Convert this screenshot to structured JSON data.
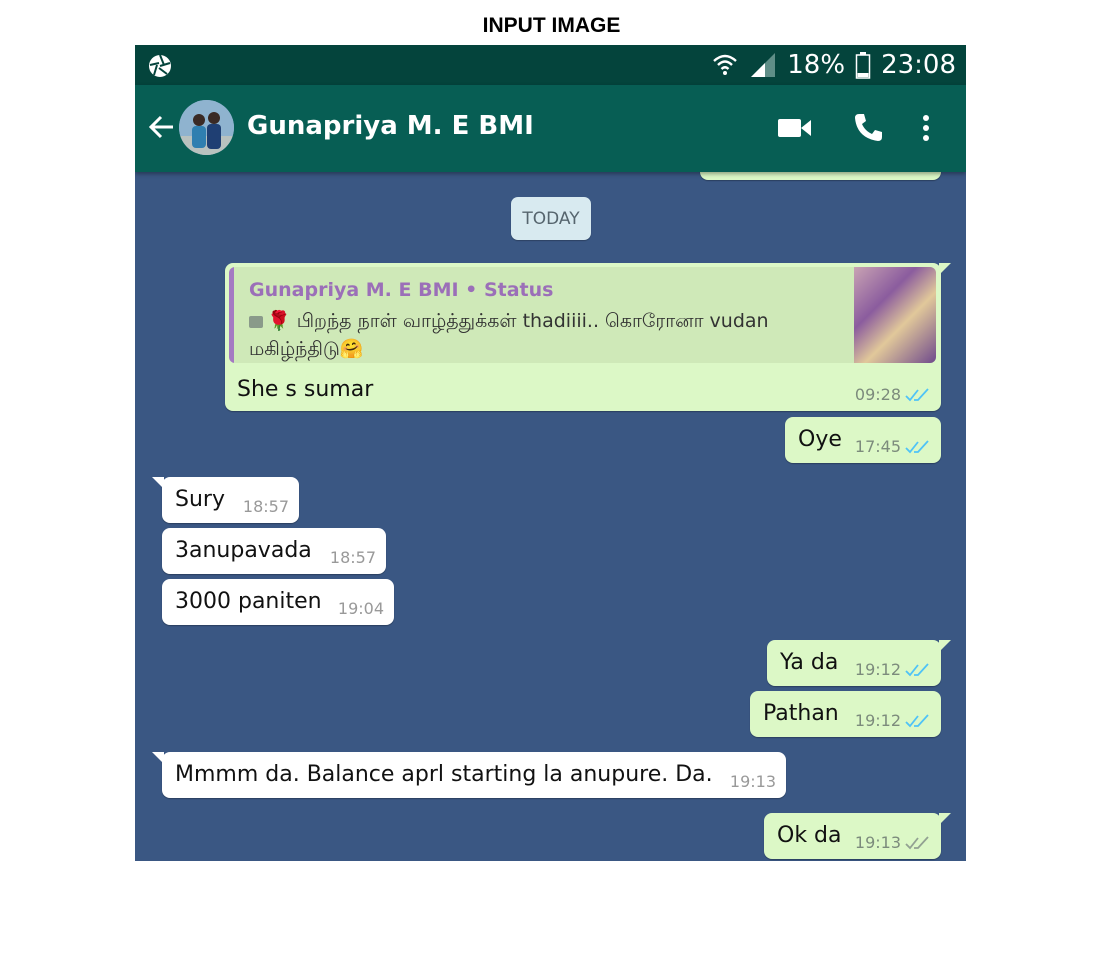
{
  "caption": "INPUT IMAGE",
  "status_bar": {
    "battery": "18%",
    "time": "23:08"
  },
  "header": {
    "contact_name": "Gunapriya M. E BMI"
  },
  "chat": {
    "date_separator": "TODAY",
    "quoted_reply": {
      "author": "Gunapriya M. E BMI • Status",
      "text": "🌹 பிறந்த நாள் வாழ்த்துக்கள் thadiiii.. கொரோனா vudan மகிழ்ந்திடு🤗",
      "message": "She s sumar",
      "time": "09:28"
    },
    "messages": [
      {
        "text": "Oye",
        "time": "17:45",
        "direction": "out",
        "status": "read"
      },
      {
        "text": "Sury",
        "time": "18:57",
        "direction": "in"
      },
      {
        "text": "3anupavada",
        "time": "18:57",
        "direction": "in"
      },
      {
        "text": "3000 paniten",
        "time": "19:04",
        "direction": "in"
      },
      {
        "text": "Ya da",
        "time": "19:12",
        "direction": "out",
        "status": "read"
      },
      {
        "text": "Pathan",
        "time": "19:12",
        "direction": "out",
        "status": "read"
      },
      {
        "text": "Mmmm da. Balance aprl starting la anupure. Da.",
        "time": "19:13",
        "direction": "in"
      },
      {
        "text": "Ok da",
        "time": "19:13",
        "direction": "out",
        "status": "delivered"
      }
    ]
  },
  "colors": {
    "status_bar": "#04443c",
    "app_bar": "#075e54",
    "chat_background": "#3a5783",
    "outgoing_bubble": "#dcf8c6",
    "incoming_bubble": "#ffffff",
    "read_tick": "#4fc3f7",
    "delivered_tick": "#92a192"
  }
}
